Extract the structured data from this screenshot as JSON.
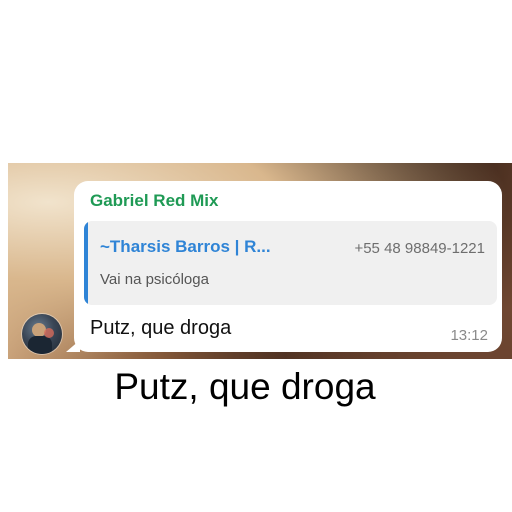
{
  "message": {
    "sender": "Gabriel Red Mix",
    "quoted": {
      "author": "~Tharsis Barros | R...",
      "phone": "+55 48 98849-1221",
      "text": "Vai na psicóloga"
    },
    "text": "Putz, que droga",
    "time": "13:12"
  },
  "caption": "Putz, que droga",
  "colors": {
    "sender_name": "#1f9a55",
    "quote_accent": "#2f84d6",
    "bubble": "#ffffff"
  }
}
